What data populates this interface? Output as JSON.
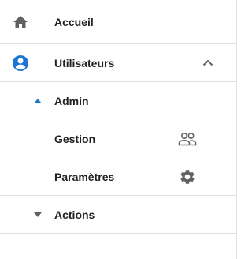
{
  "nav": {
    "items": [
      {
        "label": "Accueil",
        "icon": "home-icon"
      },
      {
        "label": "Utilisateurs",
        "icon": "account-circle-icon",
        "expanded": true,
        "children": [
          {
            "label": "Admin",
            "icon": "caret-up-icon",
            "expanded": true,
            "children": [
              {
                "label": "Gestion",
                "icon": "people-outline-icon"
              },
              {
                "label": "Paramètres",
                "icon": "gear-icon"
              }
            ]
          }
        ]
      },
      {
        "label": "Actions",
        "icon": "caret-down-icon",
        "expanded": false
      }
    ]
  },
  "colors": {
    "accent": "#1976d2",
    "icon_grey": "#616161",
    "text": "#212121",
    "divider": "#e0e0e0"
  }
}
